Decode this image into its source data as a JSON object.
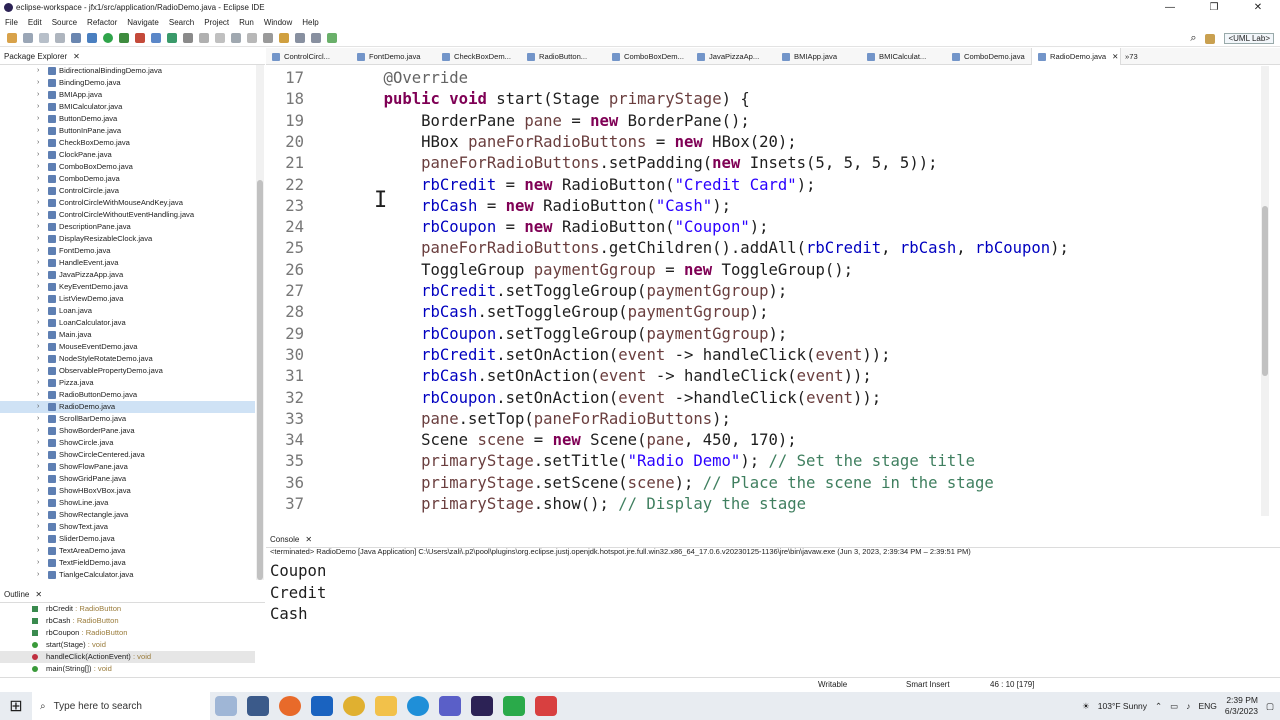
{
  "window": {
    "title": "eclipse-workspace - jfx1/src/application/RadioDemo.java - Eclipse IDE",
    "controls": [
      "—",
      "❐",
      "✕"
    ]
  },
  "menu": [
    "File",
    "Edit",
    "Source",
    "Refactor",
    "Navigate",
    "Search",
    "Project",
    "Run",
    "Window",
    "Help"
  ],
  "toolbar": {
    "uml_label": "<UML Lab>"
  },
  "package_explorer": {
    "title": "Package Explorer",
    "items": [
      "BidirectionalBindingDemo.java",
      "BindingDemo.java",
      "BMIApp.java",
      "BMICalculator.java",
      "ButtonDemo.java",
      "ButtonInPane.java",
      "CheckBoxDemo.java",
      "ClockPane.java",
      "ComboBoxDemo.java",
      "ComboDemo.java",
      "ControlCircle.java",
      "ControlCircleWithMouseAndKey.java",
      "ControlCircleWithoutEventHandling.java",
      "DescriptionPane.java",
      "DisplayResizableClock.java",
      "FontDemo.java",
      "HandleEvent.java",
      "JavaPizzaApp.java",
      "KeyEventDemo.java",
      "ListViewDemo.java",
      "Loan.java",
      "LoanCalculator.java",
      "Main.java",
      "MouseEventDemo.java",
      "NodeStyleRotateDemo.java",
      "ObservablePropertyDemo.java",
      "Pizza.java",
      "RadioButtonDemo.java",
      "RadioDemo.java",
      "ScrollBarDemo.java",
      "ShowBorderPane.java",
      "ShowCircle.java",
      "ShowCircleCentered.java",
      "ShowFlowPane.java",
      "ShowGridPane.java",
      "ShowHBoxVBox.java",
      "ShowLine.java",
      "ShowRectangle.java",
      "ShowText.java",
      "SliderDemo.java",
      "TextAreaDemo.java",
      "TextFieldDemo.java",
      "TianlgeCalculator.java"
    ],
    "selected": "RadioDemo.java"
  },
  "outline": {
    "title": "Outline",
    "items": [
      {
        "name": "rbCredit",
        "type": " : RadioButton",
        "color": "#3a8a4e"
      },
      {
        "name": "rbCash",
        "type": " : RadioButton",
        "color": "#3a8a4e"
      },
      {
        "name": "rbCoupon",
        "type": " : RadioButton",
        "color": "#3a8a4e"
      },
      {
        "name": "start(Stage)",
        "type": " : void",
        "color": "#3a9a3a"
      },
      {
        "name": "handleClick(ActionEvent)",
        "type": " : void",
        "color": "#c03040"
      },
      {
        "name": "main(String[])",
        "type": " : void",
        "color": "#3a9a3a"
      }
    ]
  },
  "tabs": [
    "ControlCircl...",
    "FontDemo.java",
    "CheckBoxDem...",
    "RadioButton...",
    "ComboBoxDem...",
    "JavaPizzaAp...",
    "BMIApp.java",
    "BMICalculat...",
    "ComboDemo.java",
    "RadioDemo.java",
    "»73"
  ],
  "active_tab": "RadioDemo.java",
  "code": [
    {
      "n": "17",
      "t": [
        [
          "ann",
          "    @Override"
        ]
      ]
    },
    {
      "n": "18",
      "t": [
        [
          "",
          "    "
        ],
        [
          "kw",
          "public"
        ],
        [
          "",
          " "
        ],
        [
          "kw",
          "void"
        ],
        [
          "",
          " start(Stage "
        ],
        [
          "var",
          "primaryStage"
        ],
        [
          "",
          ") {"
        ]
      ]
    },
    {
      "n": "19",
      "t": [
        [
          "",
          "        BorderPane "
        ],
        [
          "var",
          "pane"
        ],
        [
          "",
          " = "
        ],
        [
          "kw",
          "new"
        ],
        [
          "",
          " BorderPane();"
        ]
      ]
    },
    {
      "n": "20",
      "t": [
        [
          "",
          "        HBox "
        ],
        [
          "var",
          "paneForRadioButtons"
        ],
        [
          "",
          " = "
        ],
        [
          "kw",
          "new"
        ],
        [
          "",
          " HBox(20);"
        ]
      ]
    },
    {
      "n": "21",
      "t": [
        [
          "var",
          "        paneForRadioButtons"
        ],
        [
          "",
          ".setPadding("
        ],
        [
          "kw",
          "new"
        ],
        [
          "",
          " Insets(5, 5, 5, 5));"
        ]
      ]
    },
    {
      "n": "22",
      "t": [
        [
          "fld",
          "        rbCredit"
        ],
        [
          "",
          " = "
        ],
        [
          "kw",
          "new"
        ],
        [
          "",
          " RadioButton("
        ],
        [
          "str",
          "\"Credit Card\""
        ],
        [
          "",
          ");"
        ]
      ]
    },
    {
      "n": "23",
      "t": [
        [
          "fld",
          "        rbCash"
        ],
        [
          "",
          " = "
        ],
        [
          "kw",
          "new"
        ],
        [
          "",
          " RadioButton("
        ],
        [
          "str",
          "\"Cash\""
        ],
        [
          "",
          ");"
        ]
      ]
    },
    {
      "n": "24",
      "t": [
        [
          "fld",
          "        rbCoupon"
        ],
        [
          "",
          " = "
        ],
        [
          "kw",
          "new"
        ],
        [
          "",
          " RadioButton("
        ],
        [
          "str",
          "\"Coupon\""
        ],
        [
          "",
          ");"
        ]
      ]
    },
    {
      "n": "25",
      "t": [
        [
          "var",
          "        paneForRadioButtons"
        ],
        [
          "",
          ".getChildren().addAll("
        ],
        [
          "fld",
          "rbCredit"
        ],
        [
          "",
          ", "
        ],
        [
          "fld",
          "rbCash"
        ],
        [
          "",
          ", "
        ],
        [
          "fld",
          "rbCoupon"
        ],
        [
          "",
          ");"
        ]
      ]
    },
    {
      "n": "26",
      "t": [
        [
          "",
          "        ToggleGroup "
        ],
        [
          "var",
          "paymentGgroup"
        ],
        [
          "",
          " = "
        ],
        [
          "kw",
          "new"
        ],
        [
          "",
          " ToggleGroup();"
        ]
      ]
    },
    {
      "n": "27",
      "t": [
        [
          "fld",
          "        rbCredit"
        ],
        [
          "",
          ".setToggleGroup("
        ],
        [
          "var",
          "paymentGgroup"
        ],
        [
          "",
          ");"
        ]
      ]
    },
    {
      "n": "28",
      "t": [
        [
          "fld",
          "        rbCash"
        ],
        [
          "",
          ".setToggleGroup("
        ],
        [
          "var",
          "paymentGgroup"
        ],
        [
          "",
          ");"
        ]
      ]
    },
    {
      "n": "29",
      "t": [
        [
          "fld",
          "        rbCoupon"
        ],
        [
          "",
          ".setToggleGroup("
        ],
        [
          "var",
          "paymentGgroup"
        ],
        [
          "",
          ");"
        ]
      ]
    },
    {
      "n": "30",
      "t": [
        [
          "fld",
          "        rbCredit"
        ],
        [
          "",
          ".setOnAction("
        ],
        [
          "var",
          "event"
        ],
        [
          "",
          " -> handleClick("
        ],
        [
          "var",
          "event"
        ],
        [
          "",
          "));"
        ]
      ]
    },
    {
      "n": "31",
      "t": [
        [
          "fld",
          "        rbCash"
        ],
        [
          "",
          ".setOnAction("
        ],
        [
          "var",
          "event"
        ],
        [
          "",
          " -> handleClick("
        ],
        [
          "var",
          "event"
        ],
        [
          "",
          "));"
        ]
      ]
    },
    {
      "n": "32",
      "t": [
        [
          "fld",
          "        rbCoupon"
        ],
        [
          "",
          ".setOnAction("
        ],
        [
          "var",
          "event"
        ],
        [
          "",
          " ->handleClick("
        ],
        [
          "var",
          "event"
        ],
        [
          "",
          "));"
        ]
      ]
    },
    {
      "n": "33",
      "t": [
        [
          "var",
          "        pane"
        ],
        [
          "",
          ".setTop("
        ],
        [
          "var",
          "paneForRadioButtons"
        ],
        [
          "",
          ");"
        ]
      ]
    },
    {
      "n": "34",
      "t": [
        [
          "",
          "        Scene "
        ],
        [
          "var",
          "scene"
        ],
        [
          "",
          " = "
        ],
        [
          "kw",
          "new"
        ],
        [
          "",
          " Scene("
        ],
        [
          "var",
          "pane"
        ],
        [
          "",
          ", 450, 170);"
        ]
      ]
    },
    {
      "n": "35",
      "t": [
        [
          "var",
          "        primaryStage"
        ],
        [
          "",
          ".setTitle("
        ],
        [
          "str",
          "\"Radio Demo\""
        ],
        [
          "",
          "); "
        ],
        [
          "cmt",
          "// Set the stage title"
        ]
      ]
    },
    {
      "n": "36",
      "t": [
        [
          "var",
          "        primaryStage"
        ],
        [
          "",
          ".setScene("
        ],
        [
          "var",
          "scene"
        ],
        [
          "",
          "); "
        ],
        [
          "cmt",
          "// Place the scene in the stage"
        ]
      ]
    },
    {
      "n": "37",
      "t": [
        [
          "var",
          "        primaryStage"
        ],
        [
          "",
          ".show(); "
        ],
        [
          "cmt",
          "// Display the stage"
        ]
      ]
    }
  ],
  "console": {
    "title": "Console",
    "terminated": "<terminated> RadioDemo [Java Application] C:\\Users\\zali\\.p2\\pool\\plugins\\org.eclipse.justj.openjdk.hotspot.jre.full.win32.x86_64_17.0.6.v20230125-1136\\jre\\bin\\javaw.exe  (Jun 3, 2023, 2:39:34 PM – 2:39:51 PM)",
    "output": [
      "Coupon",
      "Credit",
      "Cash"
    ]
  },
  "status": {
    "writable": "Writable",
    "insert": "Smart Insert",
    "position": "46 : 10 [179]"
  },
  "taskbar": {
    "search_placeholder": "Type here to search",
    "weather": "103°F  Sunny",
    "lang": "ENG",
    "time": "2:39 PM",
    "date": "6/3/2023"
  }
}
